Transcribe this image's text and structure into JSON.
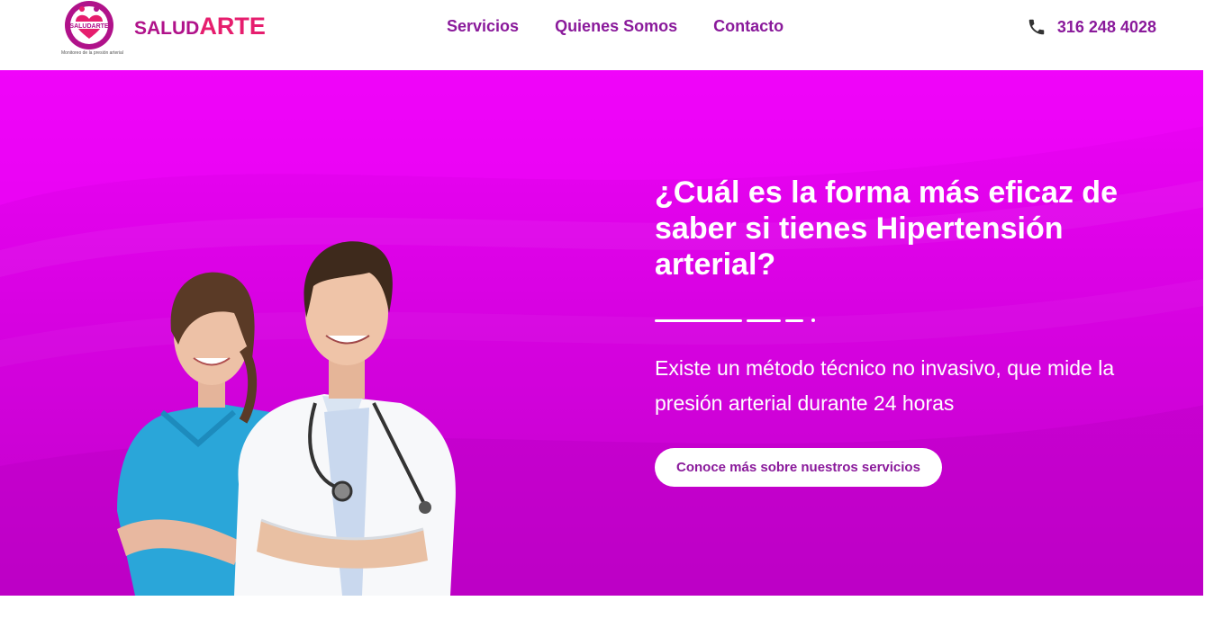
{
  "header": {
    "brand_prefix": "SALUD",
    "brand_suffix": "ARTE",
    "logo_text": "SALUDARTE",
    "logo_tagline": "Monitoreo de la presión arterial",
    "nav": [
      "Servicios",
      "Quienes Somos",
      "Contacto"
    ],
    "phone": "316 248 4028",
    "phone_icon": "phone-icon"
  },
  "hero": {
    "headline": "¿Cuál es la forma más eficaz de saber si tienes Hipertensión arterial?",
    "subtext": "Existe un método técnico no invasivo, que mide la presión arterial durante 24 horas",
    "cta": "Conoce más sobre nuestros servicios"
  },
  "colors": {
    "brand_purple": "#8a1a9b",
    "brand_magenta": "#b0128a",
    "brand_pink": "#e61e6e",
    "hero_top": "#ee02f8",
    "hero_bottom": "#c001c8"
  }
}
